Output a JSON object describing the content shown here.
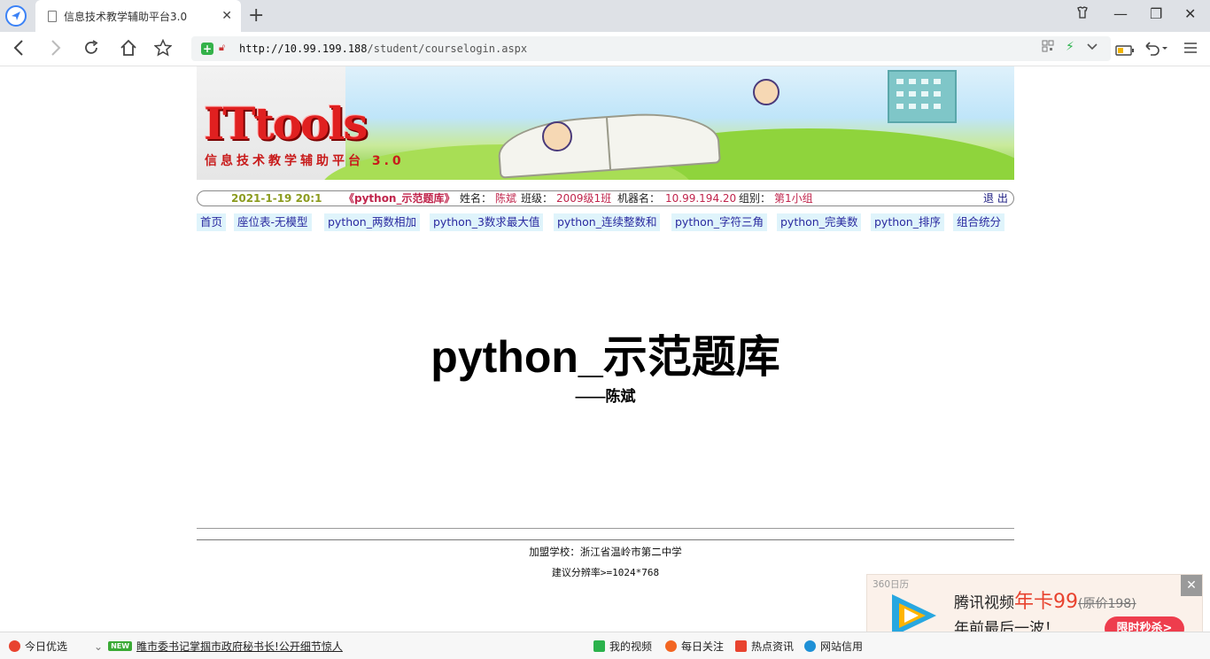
{
  "browser": {
    "tab_title": "信息技术教学辅助平台3.0",
    "url_host": "http://10.99.199.188",
    "url_path": "/student/courselogin.aspx"
  },
  "banner": {
    "logo_text": "ITtools",
    "subtitle": "信息技术教学辅助平台 3.0"
  },
  "info": {
    "date": "2021-1-19 20:1",
    "course": "《python_示范题库》",
    "name_label": "姓名：",
    "name": "陈斌",
    "class_label": "班级：",
    "class_value": "2009级1班",
    "machine_label": "机器名：",
    "machine": "10.99.194.20",
    "group_label": "组别：",
    "group": "第1小组",
    "logout": "退 出"
  },
  "menu": [
    "首页",
    "座位表-无模型",
    "python_两数相加",
    "python_3数求最大值",
    "python_连续整数和",
    "python_字符三角",
    "python_完美数",
    "python_排序",
    "组合统分"
  ],
  "main": {
    "title": "python_示范题库",
    "author": "——陈斌"
  },
  "footer": {
    "school": "加盟学校：浙江省温岭市第二中学",
    "resolution": "建议分辨率>=1024*768"
  },
  "ad": {
    "tag": "360日历",
    "line1_a": "腾讯视频",
    "line1_b": "年卡99",
    "line1_c": "(原价198)",
    "line2": "年前最后一波！",
    "button": "限时秒杀>"
  },
  "statusbar": {
    "today": "今日优选",
    "new_badge": "NEW",
    "headline": "睢市委书记掌掴市政府秘书长!公开细节惊人",
    "my_video": "我的视频",
    "daily": "每日关注",
    "hot": "热点资讯",
    "site": "网站信用"
  },
  "colors": {
    "accent_red": "#c0254c",
    "menu_bg": "#dff4fb",
    "menu_text": "#2a2aa0",
    "date_olive": "#8b9b1e"
  }
}
